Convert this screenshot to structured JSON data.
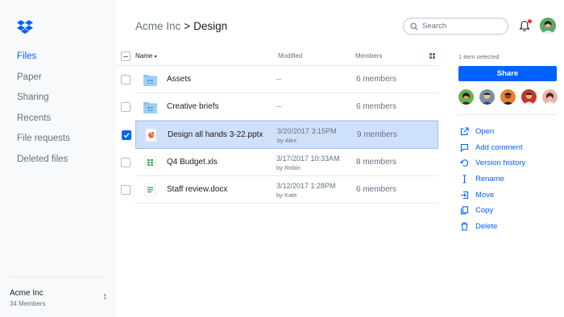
{
  "colors": {
    "accent": "#0061fe",
    "selected_row": "#cfe1fa",
    "sidebar_bg": "#f7f9fa",
    "notification": "#f02d2d"
  },
  "sidebar": {
    "logo_icon": "dropbox-logo",
    "items": [
      {
        "label": "Files",
        "active": true
      },
      {
        "label": "Paper",
        "active": false
      },
      {
        "label": "Sharing",
        "active": false
      },
      {
        "label": "Recents",
        "active": false
      },
      {
        "label": "File requests",
        "active": false
      },
      {
        "label": "Deleted files",
        "active": false
      }
    ],
    "team": {
      "name": "Acme Inc",
      "members": "34 Members"
    }
  },
  "header": {
    "breadcrumb_parent": "Acme Inc",
    "breadcrumb_separator": ">",
    "breadcrumb_current": "Design",
    "search_placeholder": "Search"
  },
  "list": {
    "columns": {
      "name": "Name",
      "modified": "Modified",
      "members": "Members"
    },
    "rows": [
      {
        "name": "Assets",
        "icon": "shared-folder-icon",
        "modified": "--",
        "by": "",
        "members": "6 members",
        "selected": false
      },
      {
        "name": "Creative briefs",
        "icon": "shared-folder-icon",
        "modified": "--",
        "by": "",
        "members": "6 members",
        "selected": false
      },
      {
        "name": "Design all hands 3-22.pptx",
        "icon": "powerpoint-file-icon",
        "modified": "3/20/2017 3:15PM",
        "by": "by Alex",
        "members": "9 members",
        "selected": true
      },
      {
        "name": "Q4 Budget.xls",
        "icon": "spreadsheet-file-icon",
        "modified": "3/17/2017 10:33AM",
        "by": "by Robin",
        "members": "8 members",
        "selected": false
      },
      {
        "name": "Staff review.docx",
        "icon": "document-file-icon",
        "modified": "3/12/2017 1:28PM",
        "by": "by Kate",
        "members": "6 members",
        "selected": false
      }
    ]
  },
  "panel": {
    "selected_count": "1 item selected",
    "share_label": "Share",
    "actions": [
      {
        "label": "Open",
        "icon": "open-external-icon"
      },
      {
        "label": "Add comment",
        "icon": "comment-icon"
      },
      {
        "label": "Version history",
        "icon": "history-icon"
      },
      {
        "label": "Rename",
        "icon": "rename-cursor-icon"
      },
      {
        "label": "Move",
        "icon": "move-icon"
      },
      {
        "label": "Copy",
        "icon": "copy-icon"
      },
      {
        "label": "Delete",
        "icon": "trash-icon"
      }
    ]
  }
}
